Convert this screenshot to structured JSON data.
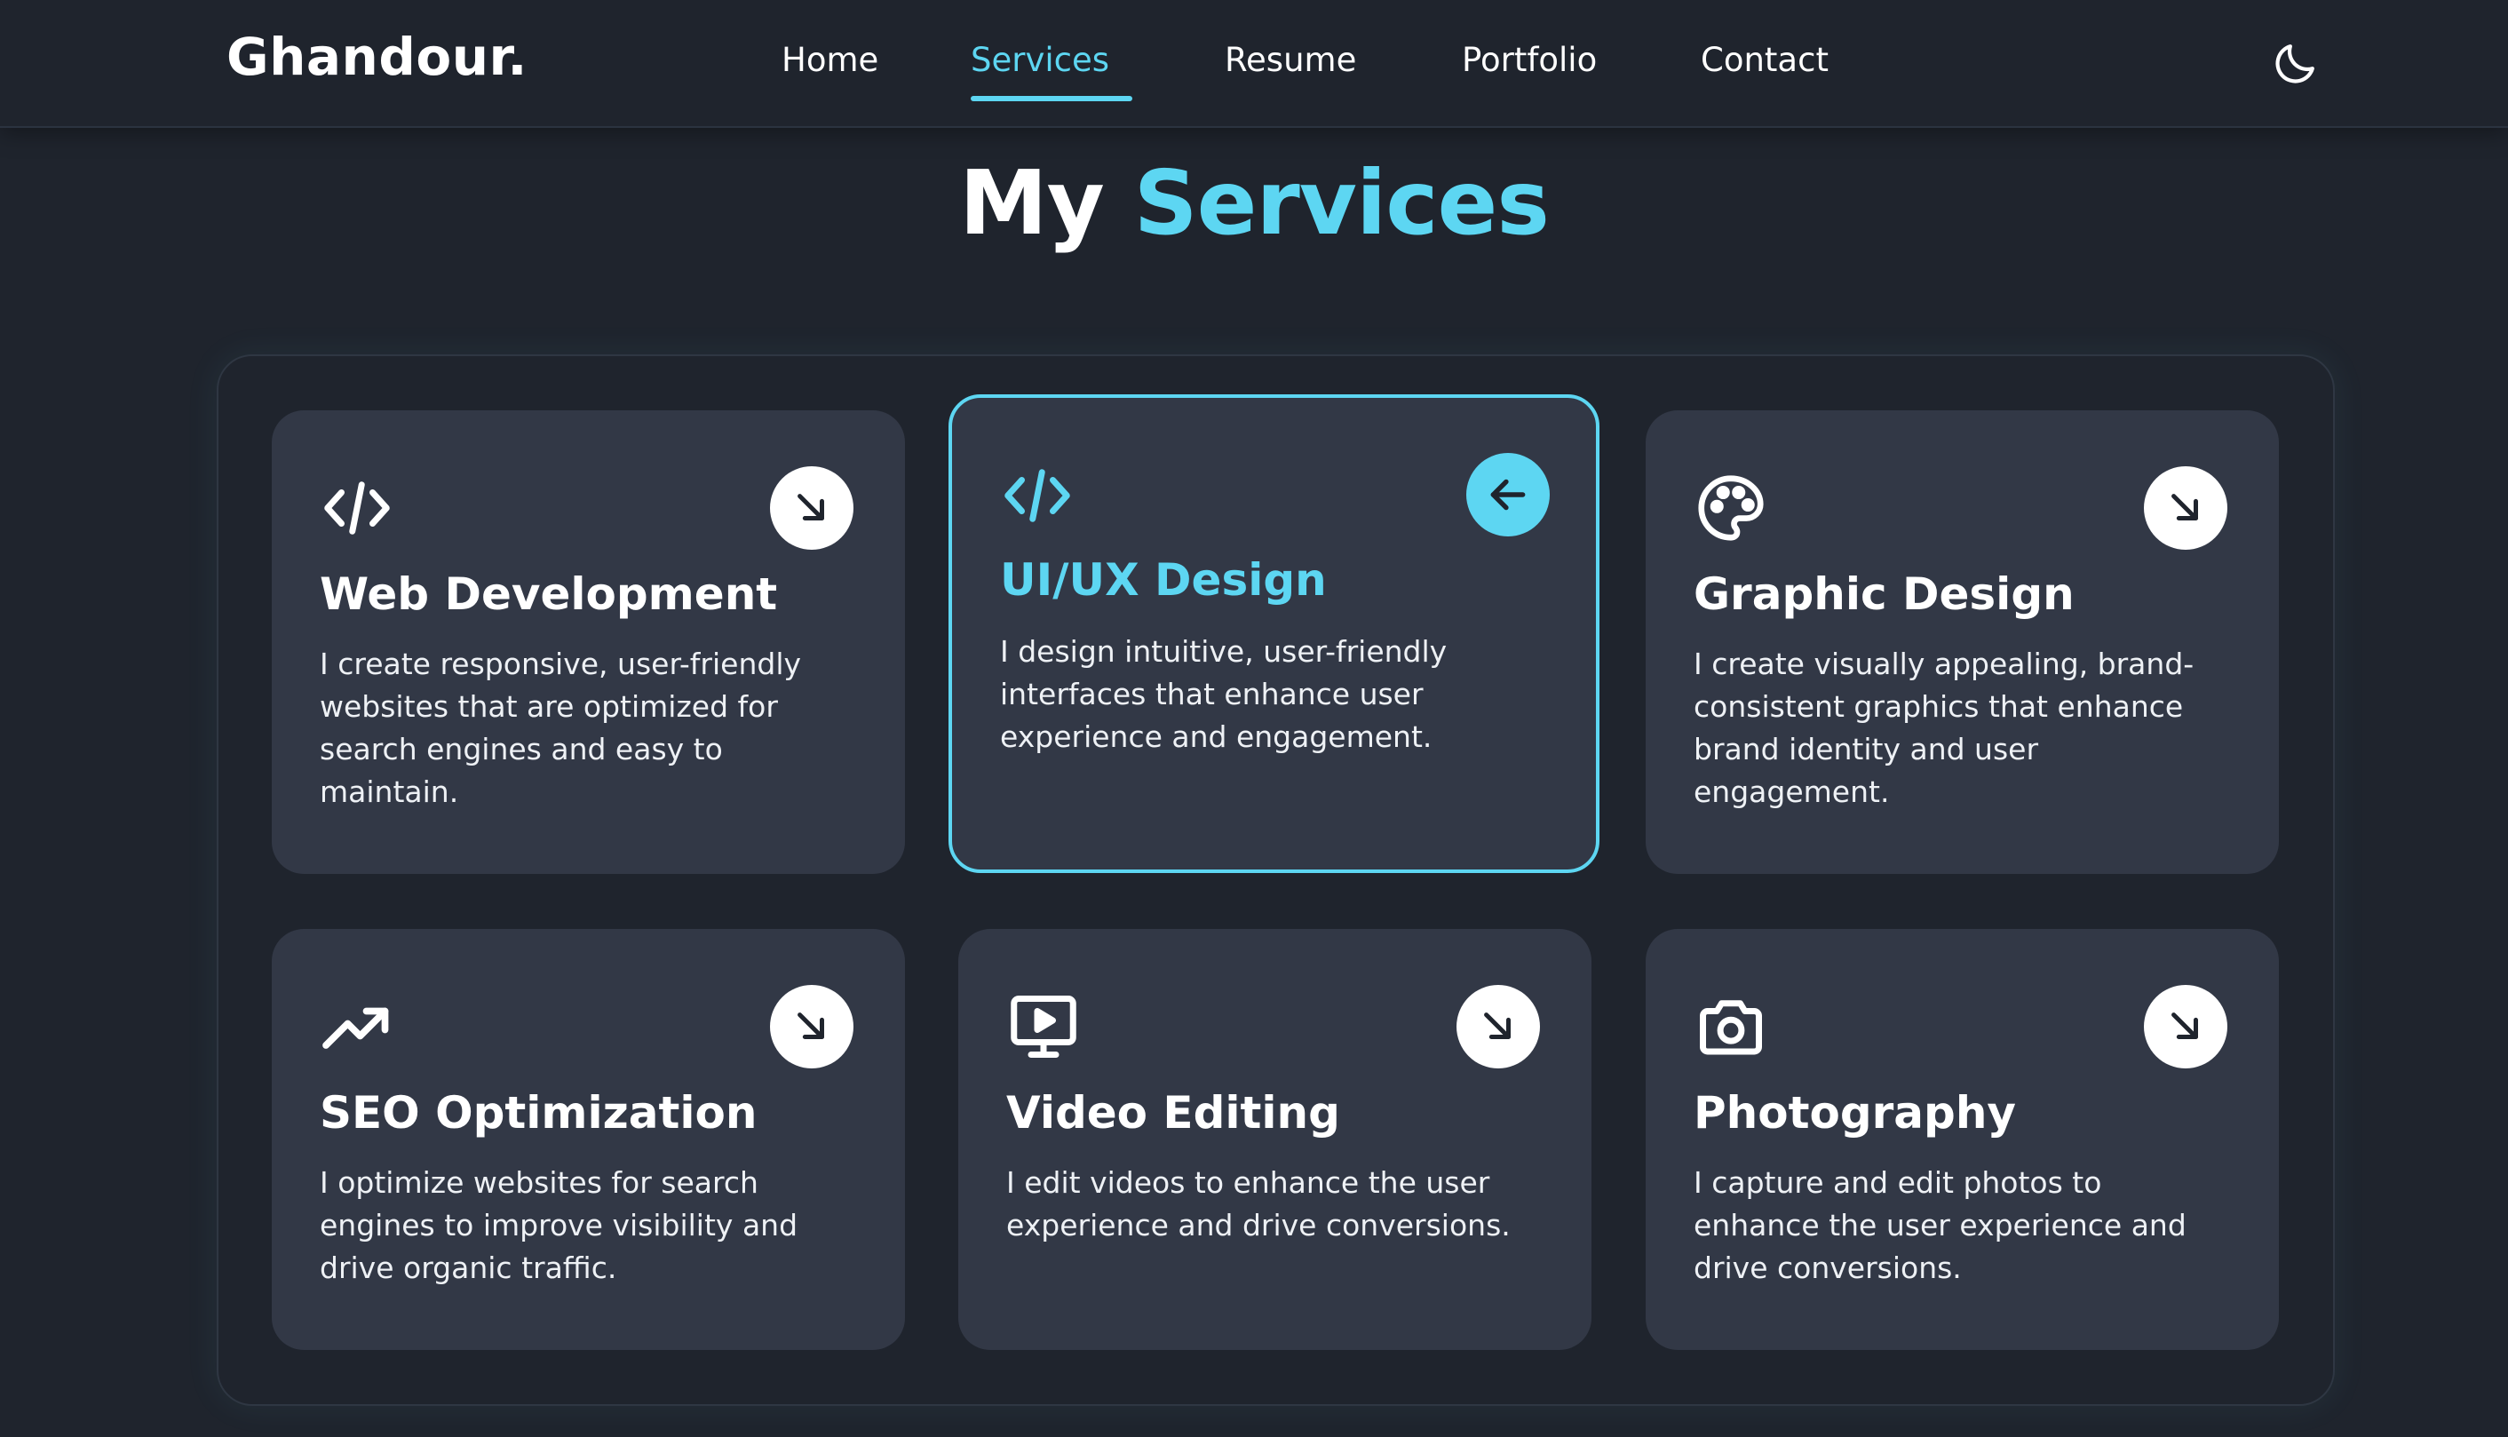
{
  "header": {
    "logo": "Ghandour.",
    "nav": [
      {
        "label": "Home"
      },
      {
        "label": "Services",
        "active": true
      },
      {
        "label": "Resume"
      },
      {
        "label": "Portfolio"
      },
      {
        "label": "Contact"
      }
    ],
    "theme_icon": "moon-icon"
  },
  "title": {
    "part1": "My",
    "part2": "Services"
  },
  "colors": {
    "accent": "#5dd6f2",
    "background": "#1f242d",
    "card": "#323846"
  },
  "services": [
    {
      "icon": "code-icon",
      "title": "Web Development",
      "description": "I create responsive, user-friendly websites that are optimized for search engines and easy to maintain.",
      "arrow": "arrow-down-right-icon"
    },
    {
      "icon": "code-icon",
      "title": "UI/UX Design",
      "description": "I design intuitive, user-friendly interfaces that enhance user experience and engagement.",
      "arrow": "arrow-left-icon",
      "active": true
    },
    {
      "icon": "palette-icon",
      "title": "Graphic Design",
      "description": "I create visually appealing, brand-consistent graphics that enhance brand identity and user engagement.",
      "arrow": "arrow-down-right-icon"
    },
    {
      "icon": "trending-up-icon",
      "title": "SEO Optimization",
      "description": "I optimize websites for search engines to improve visibility and drive organic traffic.",
      "arrow": "arrow-down-right-icon"
    },
    {
      "icon": "video-monitor-icon",
      "title": "Video Editing",
      "description": "I edit videos to enhance the user experience and drive conversions.",
      "arrow": "arrow-down-right-icon"
    },
    {
      "icon": "camera-icon",
      "title": "Photography",
      "description": "I capture and edit photos to enhance the user experience and drive conversions.",
      "arrow": "arrow-down-right-icon"
    }
  ]
}
